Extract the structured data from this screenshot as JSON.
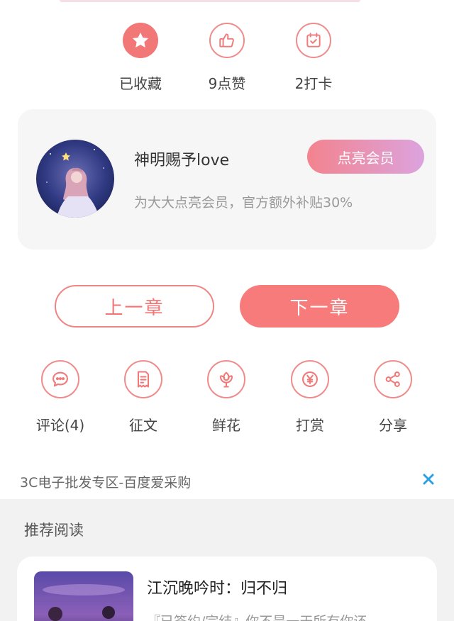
{
  "reactions": [
    {
      "label": "已收藏",
      "icon": "star-icon"
    },
    {
      "label": "9点赞",
      "icon": "thumbs-up-icon"
    },
    {
      "label": "2打卡",
      "icon": "calendar-check-icon"
    }
  ],
  "member": {
    "name": "神明赐予love",
    "description": "为大大点亮会员，官方额外补贴30%",
    "vip_button": "点亮会员"
  },
  "chapter_nav": {
    "prev": "上一章",
    "next": "下一章"
  },
  "actions": [
    {
      "label": "评论(4)",
      "icon": "comment-icon"
    },
    {
      "label": "征文",
      "icon": "essay-icon"
    },
    {
      "label": "鲜花",
      "icon": "flower-icon"
    },
    {
      "label": "打赏",
      "icon": "yen-coin-icon"
    },
    {
      "label": "分享",
      "icon": "share-icon"
    }
  ],
  "ad": {
    "text": "3C电子批发专区-百度爱采购"
  },
  "recommend": {
    "title": "推荐阅读",
    "book": {
      "title": "江沉晚吟时：归不归",
      "description": "『已签约/完结』你不是一天所有你还…"
    }
  },
  "colors": {
    "accent": "#f77b7b",
    "accent_outline": "#f08b8b",
    "vip_gradient_start": "#f3838e",
    "vip_gradient_end": "#dca3de",
    "close_icon": "#2ba0e6"
  }
}
